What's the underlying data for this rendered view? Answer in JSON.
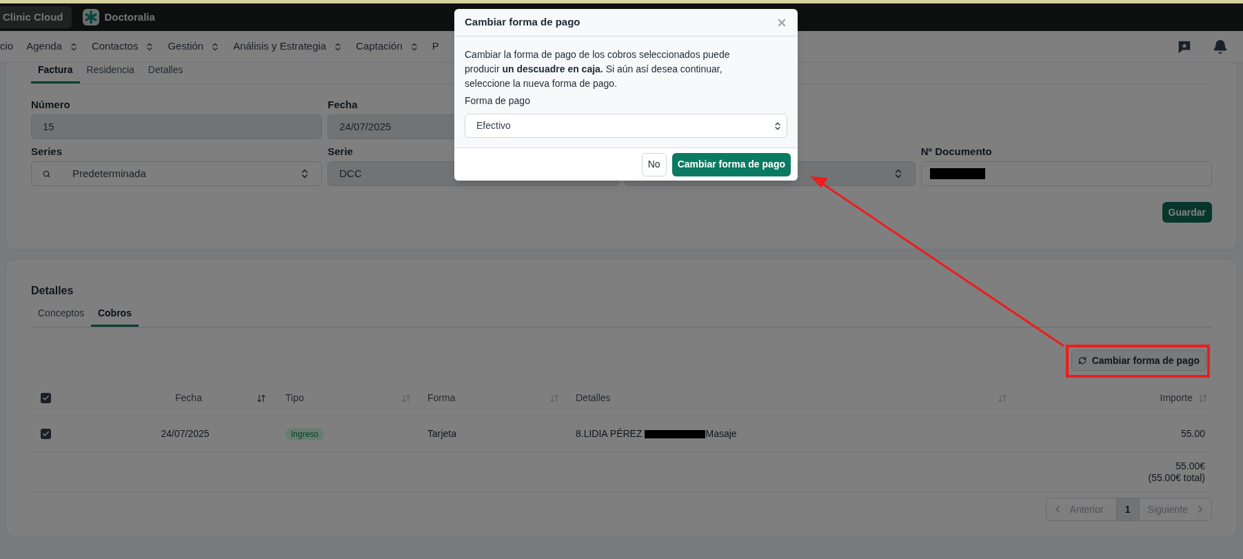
{
  "top_bar": {
    "app_button": "Clinic Cloud",
    "brand": "Doctoralia"
  },
  "nav": {
    "items": [
      {
        "label": "cio",
        "chevron": false
      },
      {
        "label": "Agenda",
        "chevron": true
      },
      {
        "label": "Contactos",
        "chevron": true
      },
      {
        "label": "Gestión",
        "chevron": true
      },
      {
        "label": "Análisis y Estrategia",
        "chevron": true
      },
      {
        "label": "Captación",
        "chevron": true
      },
      {
        "label": "P",
        "chevron": false
      }
    ]
  },
  "invoice": {
    "tabs": [
      {
        "label": "Factura",
        "selected": true
      },
      {
        "label": "Residencia",
        "selected": false
      },
      {
        "label": "Detalles",
        "selected": false
      }
    ],
    "row1": [
      {
        "kind": "text",
        "label": "Número",
        "value": "15",
        "disabled": true
      },
      {
        "kind": "text",
        "label": "Fecha",
        "value": "24/07/2025",
        "disabled": true
      }
    ],
    "row2": [
      {
        "kind": "search_select",
        "label": "Series",
        "value": "Predeterminada",
        "disabled": false
      },
      {
        "kind": "text",
        "label": "Serie",
        "value": "DCC",
        "disabled": true
      },
      {
        "kind": "select",
        "disabled": true
      },
      {
        "kind": "redacted",
        "label": "Nº Documento",
        "disabled": false
      }
    ],
    "save_button": "Guardar"
  },
  "details": {
    "title": "Detalles",
    "tabs": [
      {
        "label": "Conceptos",
        "selected": false
      },
      {
        "label": "Cobros",
        "selected": true
      }
    ],
    "change_button": "Cambiar forma de pago",
    "select_all": {
      "checked": true
    },
    "columns": [
      {
        "label": "Fecha",
        "sorted": true
      },
      {
        "label": "Tipo",
        "sorted": false
      },
      {
        "label": "Forma",
        "sorted": false
      },
      {
        "label": "Detalles",
        "sorted": false
      },
      {
        "label": "Importe",
        "sorted": false
      }
    ],
    "rows": [
      {
        "checked": true,
        "fecha": "24/07/2025",
        "tipo": "Ingreso",
        "forma": "Tarjeta",
        "detalles_before": "8.LIDIA PÉREZ",
        "detalles_after": "Masaje",
        "importe": "55.00"
      }
    ],
    "total": "55.00€",
    "total_note": "(55.00€ total)",
    "pagination": {
      "previous": "Anterior",
      "pages": [
        {
          "label": "1",
          "selected": true
        }
      ],
      "next": "Siguiente"
    }
  },
  "modal": {
    "title": "Cambiar forma de pago",
    "message": "Cambiar la forma de pago de los cobros seleccionados puede producir **un descuadre en caja.** Si aún así desea continuar, seleccione la nueva forma de pago.",
    "field_label": "Forma de pago",
    "field_value": "Efectivo",
    "buttons": [
      {
        "label": "No",
        "kind": "secondary"
      },
      {
        "label": "Cambiar forma de pago",
        "kind": "primary"
      }
    ]
  }
}
